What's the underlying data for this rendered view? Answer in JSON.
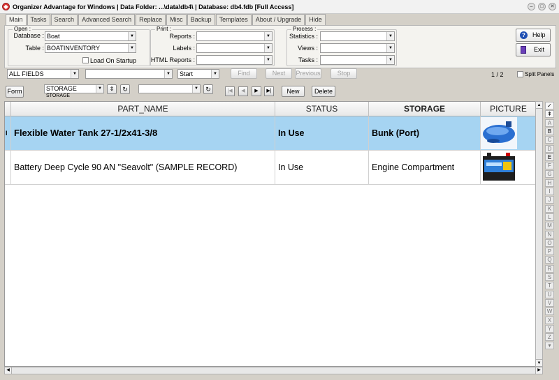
{
  "window": {
    "title": "Organizer Advantage for Windows | Data Folder: ...\\data\\db4\\ | Database: db4.fdb [Full Access]",
    "minimize": "–",
    "maximize": "□",
    "close": "✕"
  },
  "tabs": [
    "Main",
    "Tasks",
    "Search",
    "Advanced Search",
    "Replace",
    "Misc",
    "Backup",
    "Templates",
    "About / Upgrade",
    "Hide"
  ],
  "open_group": {
    "title": "Open :",
    "database_label": "Database :",
    "database_value": "Boat",
    "table_label": "Table :",
    "table_value": "BOATINVENTORY",
    "load_on_startup": "Load On Startup"
  },
  "print_group": {
    "title": "Print :",
    "reports_label": "Reports :",
    "labels_label": "Labels :",
    "html_reports_label": "HTML Reports :"
  },
  "process_group": {
    "title": "Process :",
    "statistics_label": "Statistics :",
    "views_label": "Views :",
    "tasks_label": "Tasks :"
  },
  "side_buttons": {
    "help": "Help",
    "exit": "Exit"
  },
  "search_bar": {
    "field": "ALL FIELDS",
    "query": "",
    "mode": "Start",
    "find": "Find",
    "next": "Next",
    "previous": "Previous",
    "stop": "Stop",
    "record_count": "1 / 2",
    "split_panels": "Split Panels"
  },
  "toolbar": {
    "form": "Form",
    "sort_field": "STORAGE",
    "sort_caption": "STORAGE",
    "filter": "",
    "new": "New",
    "delete": "Delete"
  },
  "grid": {
    "columns": [
      "PART_NAME",
      "STATUS",
      "STORAGE",
      "PICTURE"
    ],
    "rows": [
      {
        "marker": "I",
        "part_name": "Flexible Water Tank  27-1/2x41-3/8",
        "status": "In Use",
        "storage": "Bunk (Port)"
      },
      {
        "marker": "",
        "part_name": "Battery Deep Cycle 90 AN \"Seavolt\" (SAMPLE RECORD)",
        "status": "In Use",
        "storage": "Engine Compartment"
      }
    ]
  },
  "alpha_index": [
    "✓",
    "⇞",
    "A",
    "B",
    "C",
    "D",
    "E",
    "F",
    "G",
    "H",
    "I",
    "J",
    "K",
    "L",
    "M",
    "N",
    "O",
    "P",
    "Q",
    "R",
    "S",
    "T",
    "U",
    "V",
    "W",
    "X",
    "Y",
    "Z",
    "▾"
  ],
  "colors": {
    "selected_row": "#a6d4f2",
    "tab_strip": "#e8e6e0"
  }
}
